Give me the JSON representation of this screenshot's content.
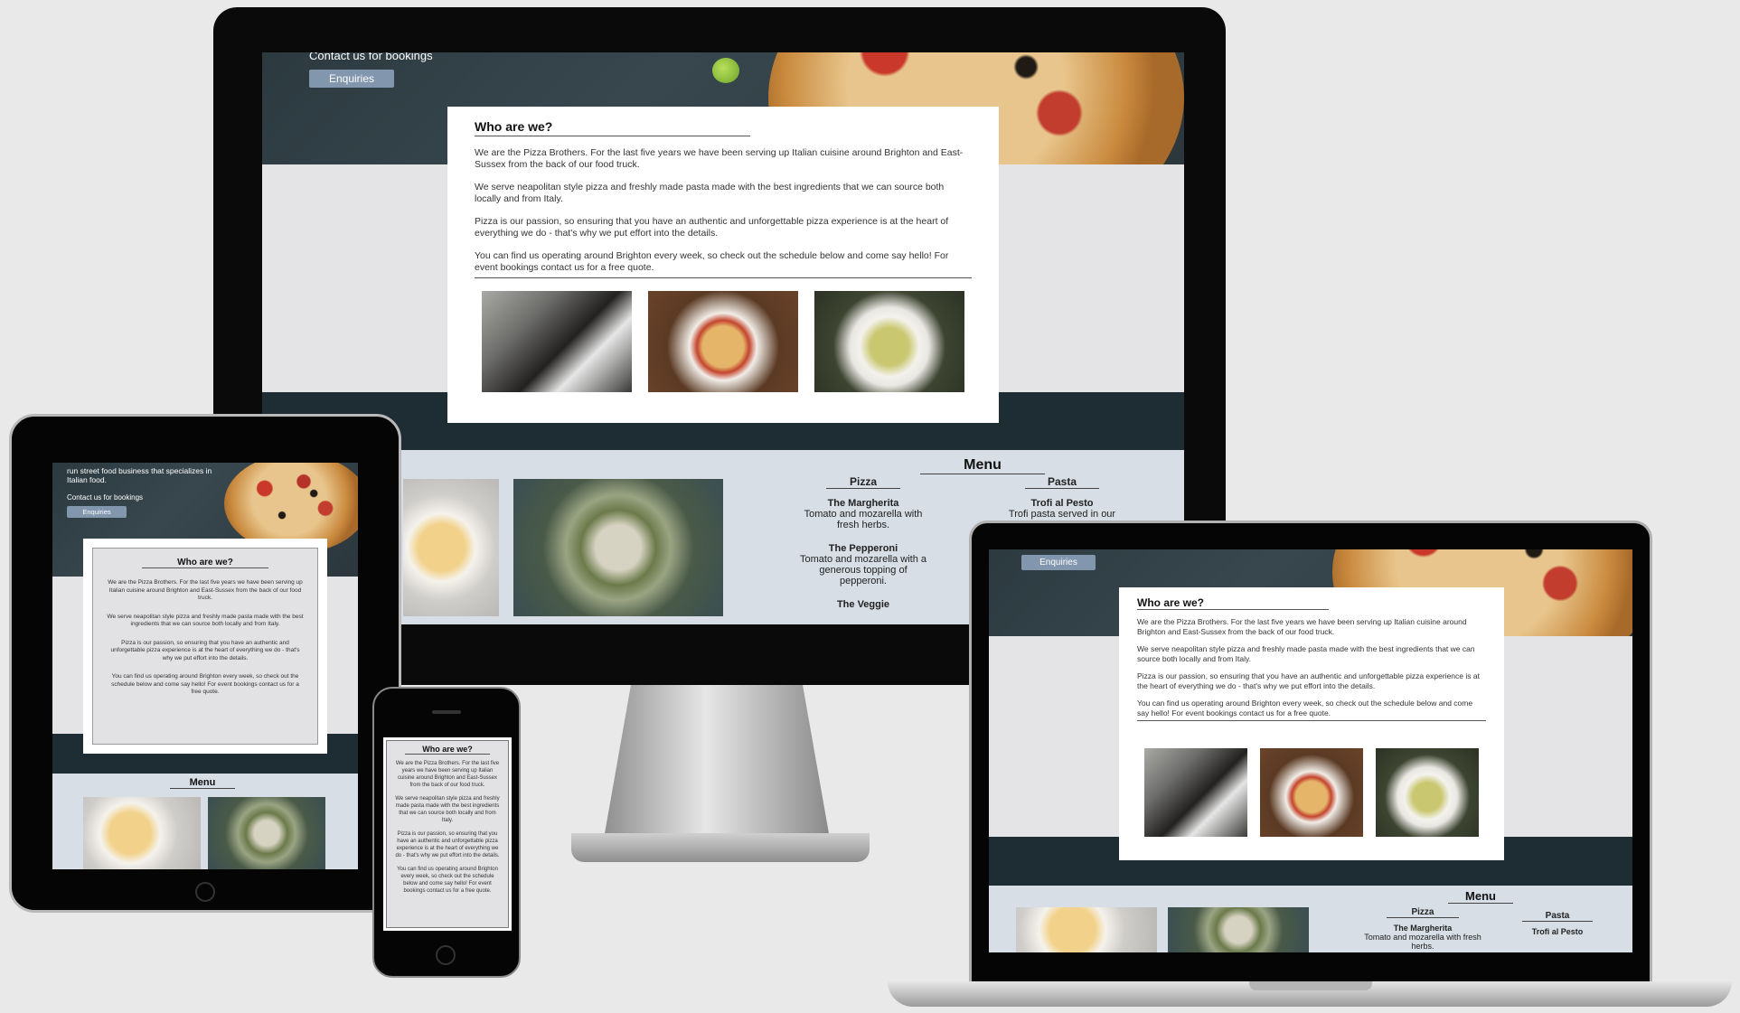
{
  "site": {
    "hero_intro": "run street food business that specializes in Italian food.",
    "contact_text": "Contact us for bookings",
    "enquiries_button": "Enquiries",
    "about": {
      "title": "Who are we?",
      "paragraphs": [
        "We are the Pizza Brothers. For the last five years we have been serving up Italian cuisine around Brighton and East-Sussex from the back of our food truck.",
        "We serve neapolitan style pizza and freshly made pasta made with the best ingredients that we can source both locally and from Italy.",
        "Pizza is our passion, so ensuring that you have an authentic and unforgettable pizza experience is at the heart of everything we do - that's why we put effort into the details.",
        "You can find us operating around Brighton every week, so check out the schedule below and come say hello! For event bookings contact us for a free quote."
      ],
      "photos": [
        "chefs-cooking-photo",
        "pizza-photo",
        "pasta-photo"
      ]
    },
    "menu": {
      "title": "Menu",
      "pizza_heading": "Pizza",
      "pasta_heading": "Pasta",
      "pizzas": [
        {
          "name": "The Margherita",
          "desc": "Tomato and mozarella with fresh herbs."
        },
        {
          "name": "The Pepperoni",
          "desc": "Tomato and mozarella with a generous topping of pepperoni."
        },
        {
          "name": "The Veggie",
          "desc": ""
        }
      ],
      "pastas": [
        {
          "name": "Trofi al Pesto",
          "desc": "Trofi pasta served in our home-"
        }
      ]
    }
  },
  "colors": {
    "page_bg": "#e9e9ea",
    "hero_dark": "#2c3a40",
    "band_dark": "#1e2d33",
    "menu_bg": "#d7dee5",
    "button": "#8296ae"
  }
}
